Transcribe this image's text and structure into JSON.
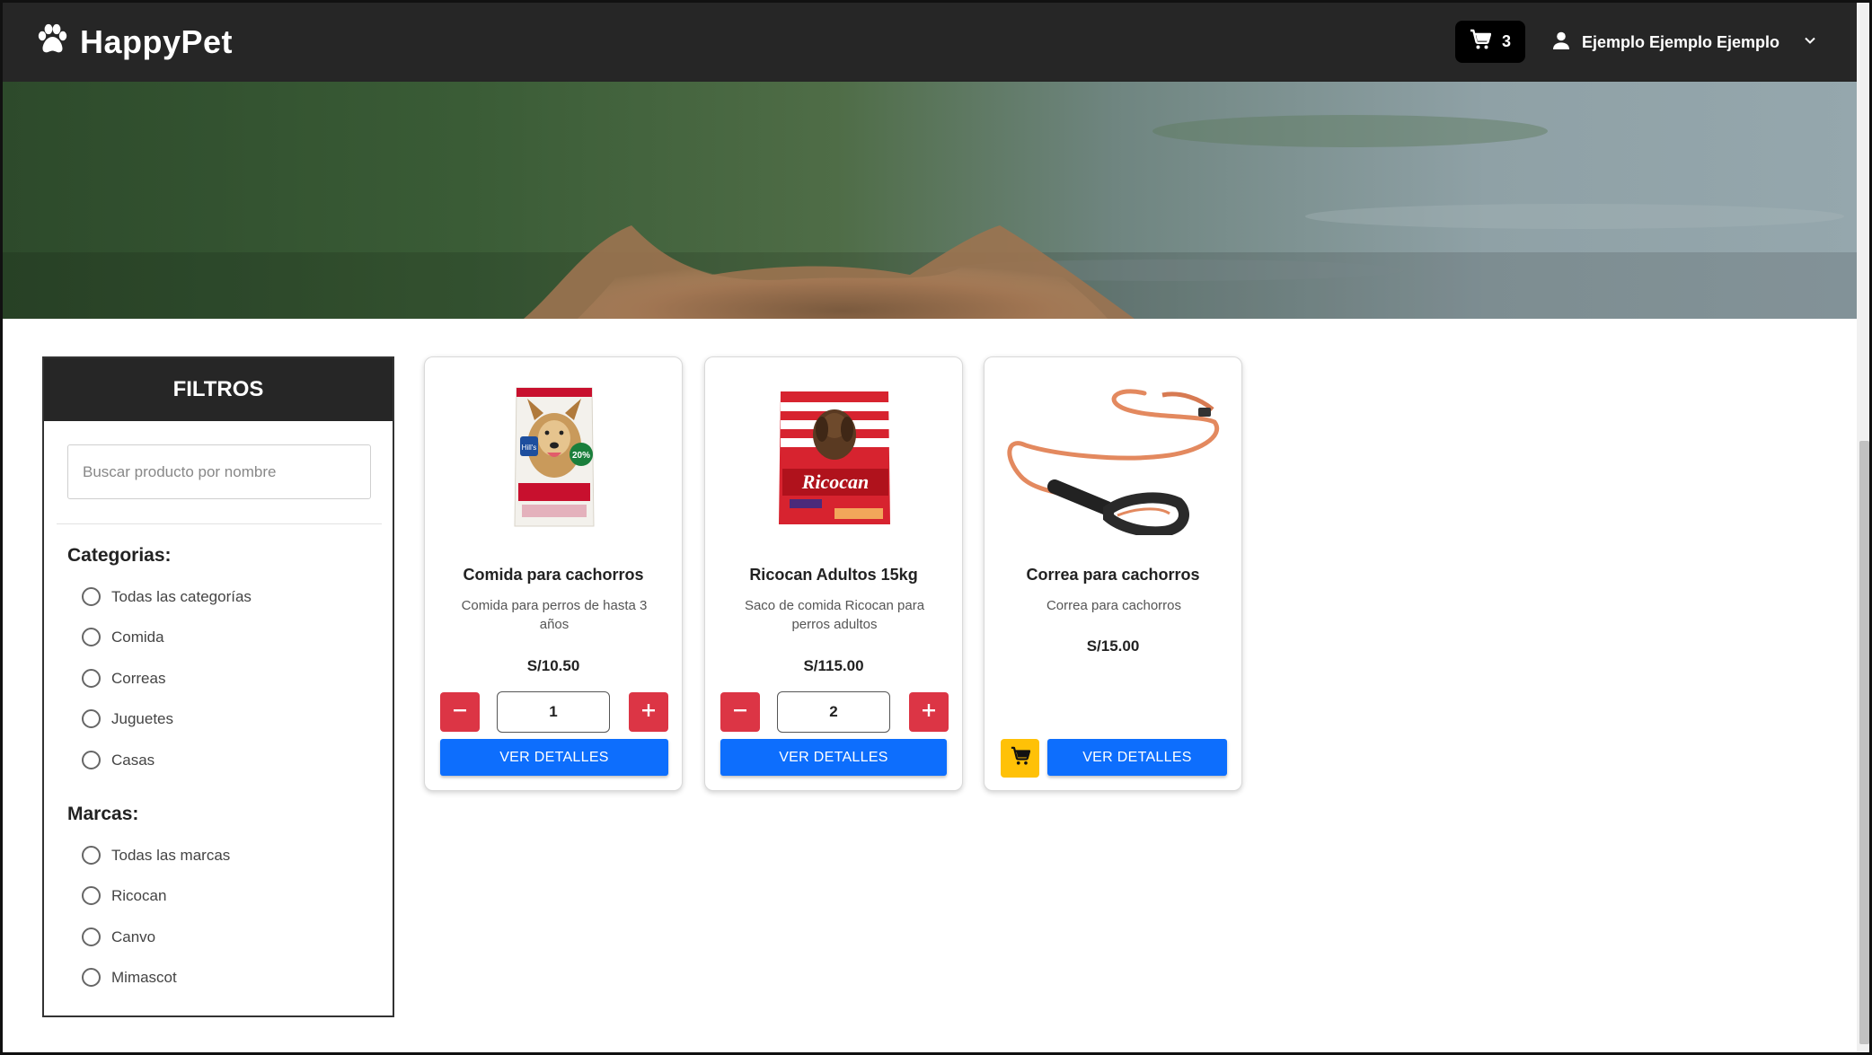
{
  "header": {
    "brand": "HappyPet",
    "cart_count": "3",
    "user_name": "Ejemplo Ejemplo Ejemplo"
  },
  "filters": {
    "title": "FILTROS",
    "search_placeholder": "Buscar producto por nombre",
    "categories_title": "Categorias:",
    "categories": [
      "Todas las categorías",
      "Comida",
      "Correas",
      "Juguetes",
      "Casas"
    ],
    "brands_title": "Marcas:",
    "brands": [
      "Todas las marcas",
      "Ricocan",
      "Canvo",
      "Mimascot"
    ]
  },
  "products": [
    {
      "name": "Comida para cachorros",
      "description": "Comida para perros de hasta 3 años",
      "price": "S/10.50",
      "quantity": "1",
      "details_label": "VER DETALLES"
    },
    {
      "name": "Ricocan Adultos 15kg",
      "description": "Saco de comida Ricocan para perros adultos",
      "price": "S/115.00",
      "quantity": "2",
      "details_label": "VER DETALLES"
    },
    {
      "name": "Correa para cachorros",
      "description": "Correa para cachorros",
      "price": "S/15.00",
      "details_label": "VER DETALLES"
    }
  ],
  "icons": {
    "logo": "paw-icon",
    "cart": "cart-icon",
    "user": "user-icon",
    "dropdown": "chevron-down-icon",
    "minus": "minus-icon",
    "plus": "plus-icon",
    "add_to_cart": "cart-icon"
  },
  "colors": {
    "navbar": "#262626",
    "primary": "#0d6efd",
    "danger": "#dc3545",
    "warning": "#ffc107"
  },
  "product_images": [
    "Hill's",
    "Ricocan"
  ]
}
